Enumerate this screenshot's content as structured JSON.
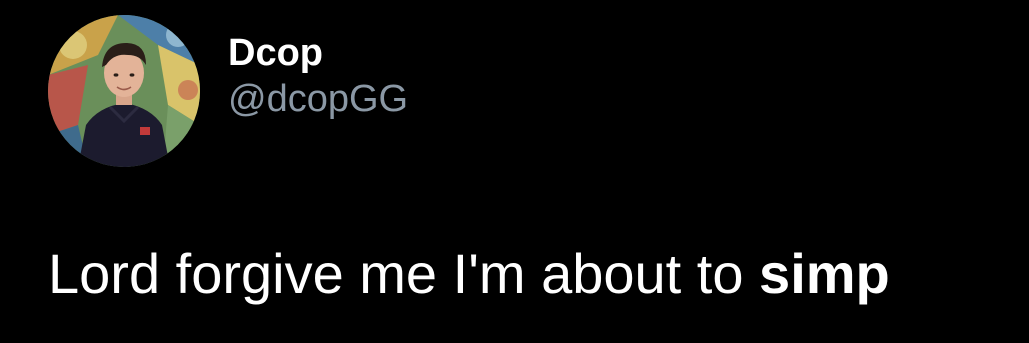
{
  "user": {
    "display_name": "Dcop",
    "handle": "@dcopGG"
  },
  "tweet": {
    "text_prefix": "Lord forgive me I'm about to ",
    "text_bold": "simp"
  },
  "colors": {
    "background": "#000000",
    "primary_text": "#ffffff",
    "secondary_text": "#8b98a5"
  }
}
